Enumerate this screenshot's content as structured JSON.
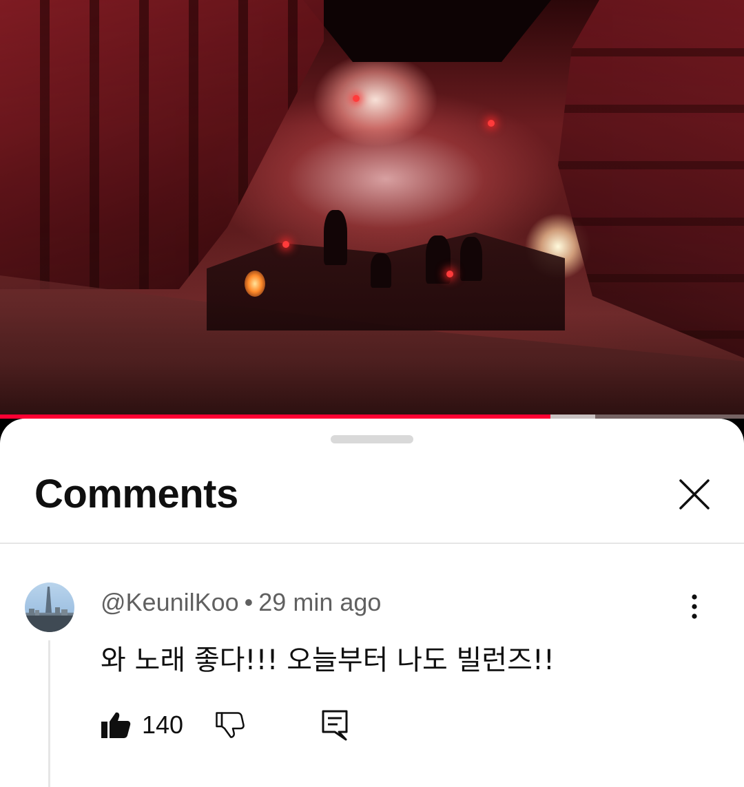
{
  "video": {
    "progress_fraction": 0.74,
    "buffered_fraction": 0.8,
    "progress_color": "#ff0033"
  },
  "comments_sheet": {
    "title": "Comments",
    "close_icon": "close-icon"
  },
  "comment": {
    "author": "@KeunilKoo",
    "separator": "•",
    "time_ago": "29 min ago",
    "text": "와 노래 좋다!!! 오늘부터 나도 빌런즈!!",
    "like_count": "140",
    "icons": {
      "like": "thumb-up-icon",
      "dislike": "thumb-down-icon",
      "reply": "reply-icon",
      "more": "more-vert-icon"
    }
  }
}
